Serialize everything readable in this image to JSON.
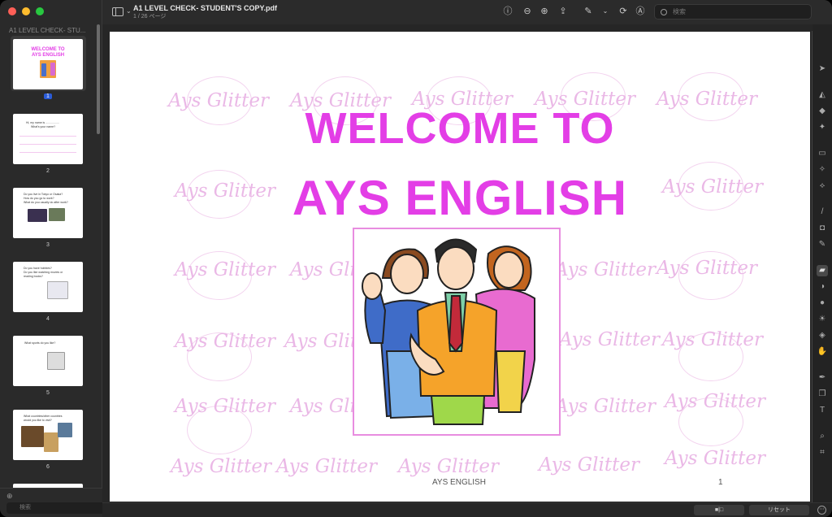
{
  "window": {
    "title": "A1 LEVEL CHECK- STUDENT'S COPY.pdf",
    "page_indicator": "1 / 26 ページ"
  },
  "sidebar": {
    "title": "A1 LEVEL CHECK- STU...",
    "search_placeholder": "検索",
    "thumbnails": [
      {
        "num": "1",
        "selected": true,
        "title1": "WELCOME TO",
        "title2": "AYS ENGLISH"
      },
      {
        "num": "2",
        "line1": "Hi, my name is .................",
        "line2": "What's your name?"
      },
      {
        "num": "3",
        "line1": "Do you live in Tokyo or Osaka?",
        "line2": "How do you go to work?",
        "line3": "What do you usually do after work?"
      },
      {
        "num": "4",
        "line1": "Do you have hobbies?",
        "line2": "Do you like watching movies or",
        "line3": "reading books?"
      },
      {
        "num": "5",
        "line1": "What sports do you like?"
      },
      {
        "num": "6",
        "line1": "What countries/other countries",
        "line2": "would you like to visit?"
      }
    ]
  },
  "toolbar": {
    "search_placeholder": "検索",
    "icons": [
      "info-icon",
      "zoom-out-icon",
      "zoom-in-icon",
      "share-icon",
      "markup-pen-icon",
      "chevron-down-icon",
      "rotate-icon",
      "markup-circle-icon"
    ]
  },
  "page": {
    "heading_line1": "WELCOME TO",
    "heading_line2": "AYS ENGLISH",
    "watermark": "Ays Glitter",
    "footer_left": "AYS ENGLISH",
    "footer_right": "1"
  },
  "bottombar": {
    "view_button": "■|□",
    "reset_button": "リセット"
  },
  "colors": {
    "heading": "#e33ee6",
    "watermark": "#eab8e6",
    "selection": "#2a5bd7"
  }
}
